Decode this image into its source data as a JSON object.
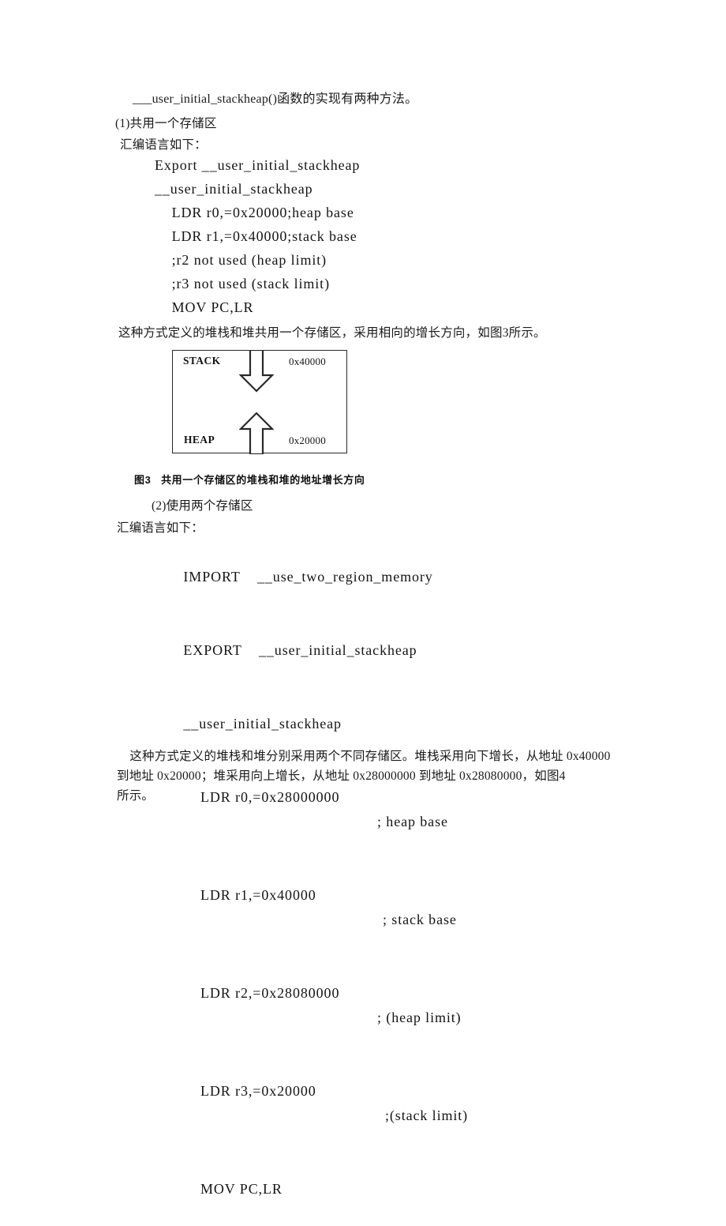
{
  "document": {
    "intro_line": "___user_initial_stackheap()函数的实现有两种方法。",
    "section1_heading": "(1)共用一个存储区",
    "section1_lead": "汇编语言如下：",
    "code1": [
      "Export __user_initial_stackheap",
      "__user_initial_stackheap",
      "    LDR r0,=0x20000;heap base",
      "    LDR r1,=0x40000;stack base",
      "    ;r2 not used (heap limit)",
      "    ;r3 not used (stack limit)",
      "    MOV PC,LR"
    ],
    "para_after_code1": "这种方式定义的堆栈和堆共用一个存储区，采用相向的增长方向，如图3所示。",
    "figure3": {
      "caption": "图3   共用一个存储区的堆栈和堆的地址增长方向",
      "stack_label": "STACK",
      "stack_address": "0x40000",
      "heap_label": "HEAP",
      "heap_address": "0x20000",
      "stack_arrow_direction": "down",
      "heap_arrow_direction": "up",
      "border_color": "#2a2a2a"
    },
    "section2_heading": "(2)使用两个存储区",
    "section2_lead": "汇编语言如下：",
    "code2": [
      {
        "text": "IMPORT    __use_two_region_memory",
        "comment": ""
      },
      {
        "text": "EXPORT    __user_initial_stackheap",
        "comment": ""
      },
      {
        "text": "__user_initial_stackheap",
        "comment": ""
      },
      {
        "text": "    LDR r0,=0x28000000",
        "comment": "; heap base"
      },
      {
        "text": "    LDR r1,=0x40000",
        "comment": "; stack base"
      },
      {
        "text": "    LDR r2,=0x28080000",
        "comment": "; (heap limit)"
      },
      {
        "text": "    LDR r3,=0x20000",
        "comment": ";(stack limit)"
      },
      {
        "text": "    MOV PC,LR",
        "comment": ""
      }
    ],
    "para_after_code2_line1": "    这种方式定义的堆栈和堆分别采用两个不同存储区。堆栈采用向下增长，从地址 0x40000",
    "para_after_code2_line2": "到地址 0x20000；堆采用向上增长，从地址 0x28000000 到地址 0x28080000，如图4",
    "para_after_code2_line3": "所示。"
  }
}
